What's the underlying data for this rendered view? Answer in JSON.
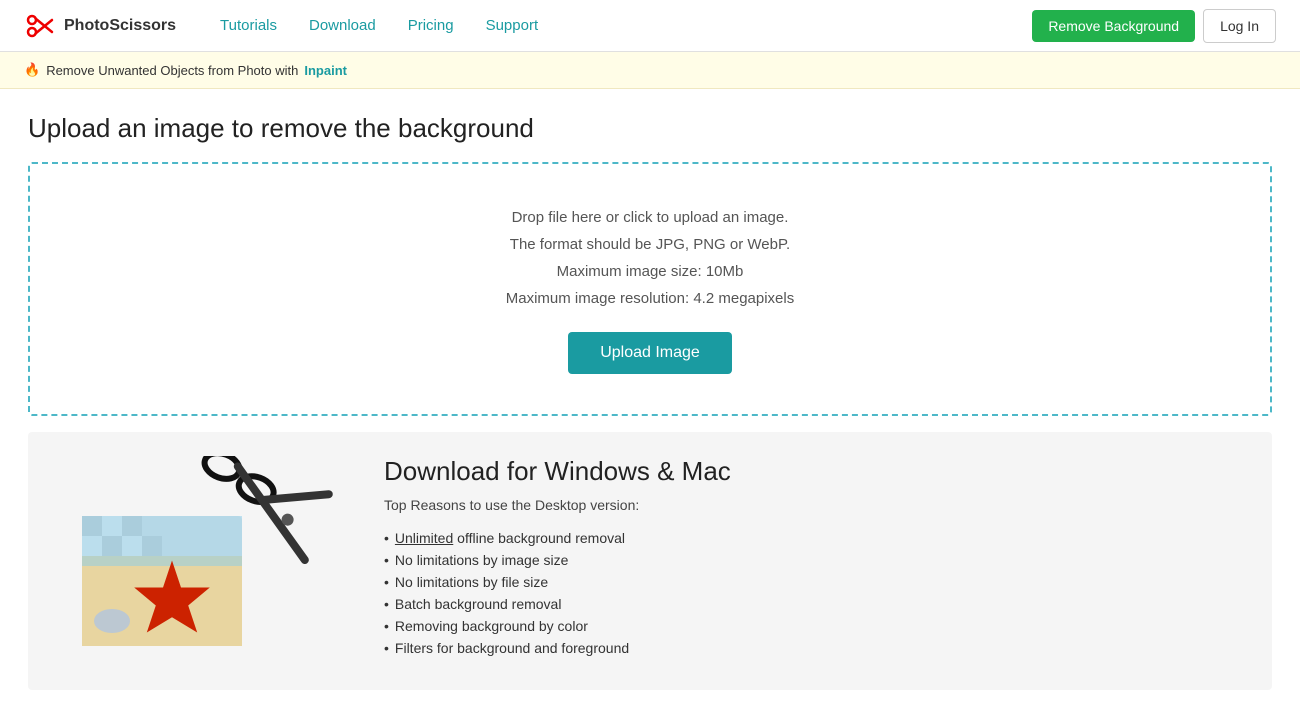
{
  "header": {
    "logo_text": "PhotoScissors",
    "nav_items": [
      {
        "label": "Tutorials",
        "href": "#"
      },
      {
        "label": "Download",
        "href": "#"
      },
      {
        "label": "Pricing",
        "href": "#"
      },
      {
        "label": "Support",
        "href": "#"
      }
    ],
    "remove_bg_label": "Remove Background",
    "login_label": "Log In"
  },
  "banner": {
    "icon": "🔥",
    "text": "Remove Unwanted Objects from Photo with",
    "link_text": "Inpaint",
    "link_href": "#"
  },
  "main": {
    "page_title": "Upload an image to remove the background",
    "upload": {
      "line1": "Drop file here or click to upload an image.",
      "line2": "The format should be JPG, PNG or WebP.",
      "line3": "Maximum image size: 10Mb",
      "line4": "Maximum image resolution: 4.2 megapixels",
      "button_label": "Upload Image"
    },
    "download_section": {
      "title": "Download for Windows & Mac",
      "subtitle": "Top Reasons to use the Desktop version:",
      "features": [
        {
          "text": "Unlimited",
          "underline": true,
          "suffix": " offline background removal"
        },
        {
          "text": "No limitations by image size"
        },
        {
          "text": "No limitations by file size"
        },
        {
          "text": "Batch background removal"
        },
        {
          "text": "Removing background by color"
        },
        {
          "text": "Filters for background and foreground"
        }
      ]
    }
  },
  "colors": {
    "teal": "#1a9ba1",
    "green": "#22b14c",
    "dashed_border": "#4db8c8"
  }
}
